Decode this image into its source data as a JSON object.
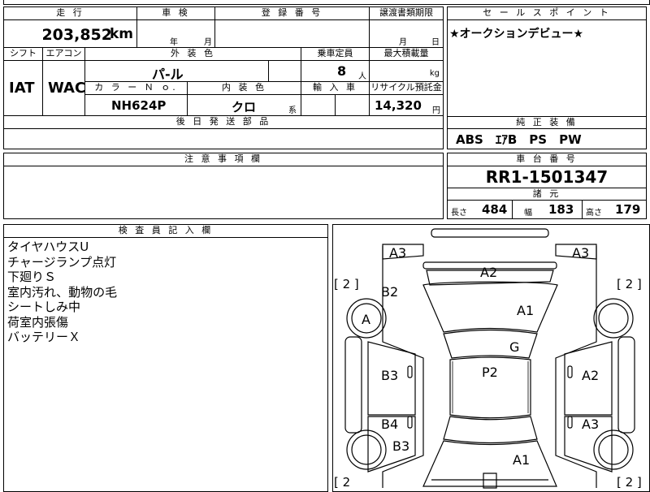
{
  "vehicle": {
    "mileage_label": "走 行",
    "mileage": "203,852",
    "mileage_unit": "km",
    "inspection_label": "車 検",
    "inspection_year_unit": "年",
    "inspection_month_unit": "月",
    "registration_label": "登 録 番 号",
    "transfer_deadline_label": "譲渡書類期限",
    "transfer_month_unit": "月",
    "transfer_day_unit": "日",
    "shift_label": "シフト",
    "shift": "IAT",
    "ac_label": "エアコン",
    "ac": "WAC",
    "exterior_color_label": "外 装 色",
    "exterior_color": "パ-ル",
    "capacity_label": "乗車定員",
    "capacity": "8",
    "capacity_unit": "人",
    "max_load_label": "最大積載量",
    "max_load_unit": "kg",
    "color_no_label": "カ ラ ー Ｎ ｏ.",
    "color_no": "NH624P",
    "interior_color_label": "内 装 色",
    "interior_color": "クロ",
    "interior_suffix": "系",
    "import_label": "輸 入 車",
    "recycle_label": "リサイクル預託金",
    "recycle_fee": "14,320",
    "recycle_unit": "円",
    "parts_label": "後 日 発 送 部 品",
    "sales_point_label": "セ ー ル ス ポ イ ン ト",
    "sales_point": "★オークションデビュー★",
    "equipment_label": "純 正 装 備",
    "equipment": "ABS　ｴｱB　PS　PW",
    "caution_label": "注 意 事 項 欄",
    "chassis_label": "車 台 番 号",
    "chassis_no": "RR1-1501347",
    "specs_label": "諸 元",
    "length_label": "長さ",
    "length": "484",
    "width_label": "幅",
    "width": "183",
    "height_label": "高さ",
    "height": "179"
  },
  "inspector": {
    "label": "検 査 員 記 入 欄",
    "notes": [
      "タイヤハウスU",
      "チャージランプ点灯",
      "下廻りＳ",
      "室内汚れ、動物の毛",
      "シートしみ中",
      "荷室内張傷",
      "バッテリーＸ"
    ]
  },
  "diagram": {
    "marks": {
      "front_left_corner": "A3",
      "front_right_corner": "A3",
      "front_bumper": "A2",
      "hood": "A1",
      "front_left_fender": "B2",
      "front_left_wheel": "A",
      "windshield": "G",
      "roof": "P2",
      "front_left_door": "B3",
      "rear_left_door": "B4",
      "front_right_door": "A2",
      "rear_right_door": "A3",
      "rear_left_fender": "B3",
      "rear_gate": "A1"
    },
    "tire_left_front": "[ 2 ]",
    "tire_right_front": "[ 2 ]",
    "tire_left_rear": "[ 2",
    "tire_right_rear": "[ 2 ]"
  }
}
